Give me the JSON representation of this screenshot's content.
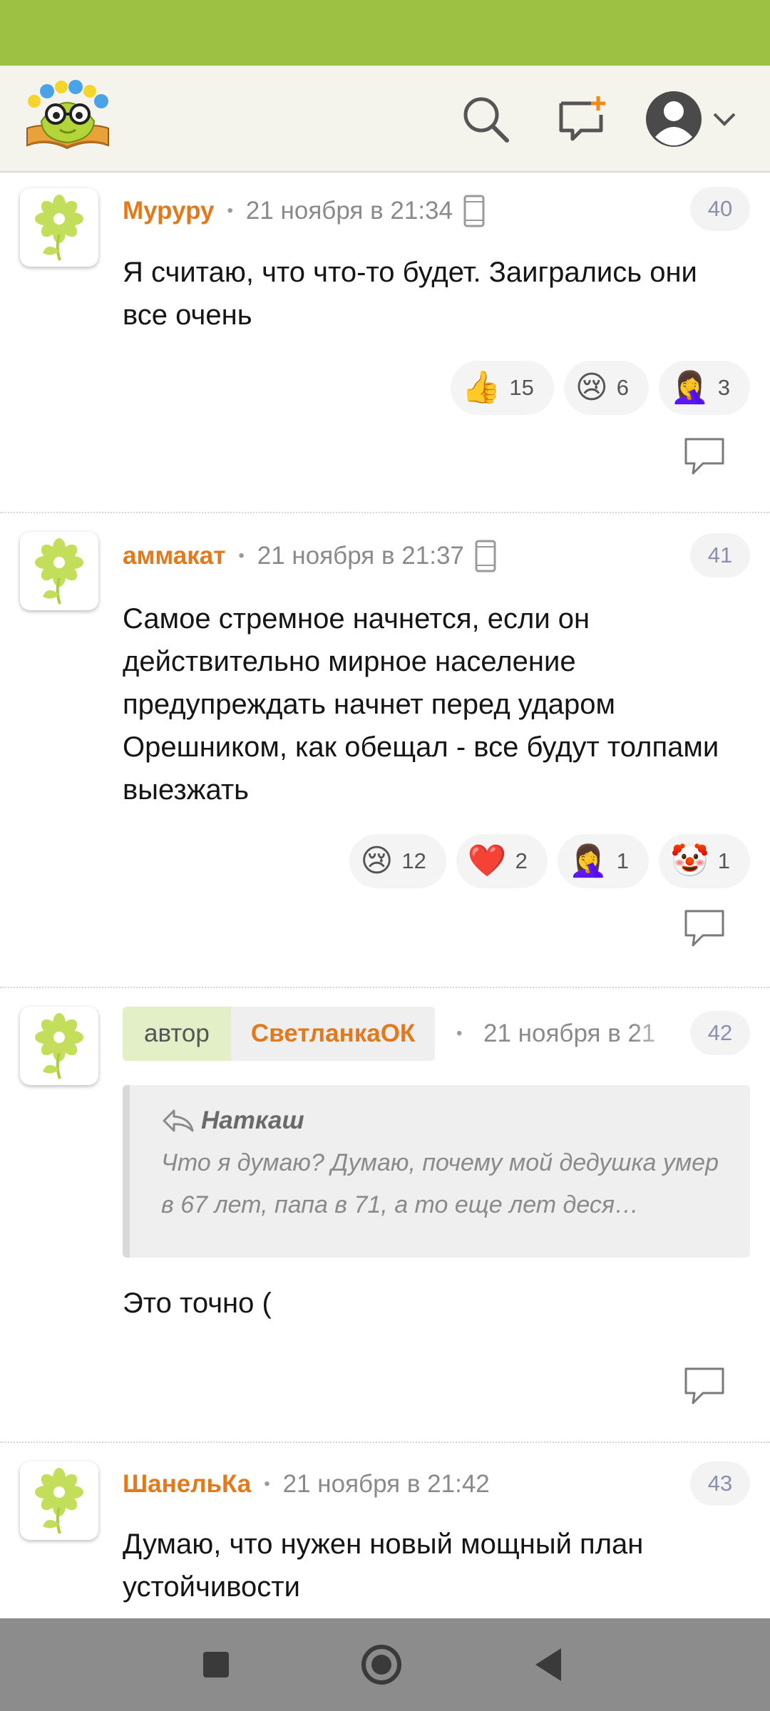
{
  "header": {
    "search_icon": "search-icon",
    "new_post_icon": "new-post-icon",
    "profile_icon": "profile-avatar-icon"
  },
  "colors": {
    "statusbar": "#9dc143",
    "author": "#e27a1d",
    "author_tag_bg": "#e3efc6"
  },
  "comments": [
    {
      "author": "Мururu",
      "author_display": "Муруру",
      "time": "21 ноября в 21:34",
      "number": "40",
      "device": "phone-icon",
      "text": "Я считаю, что что-то будет. Заигрались они все очень",
      "reactions": [
        {
          "emoji": "👍",
          "count": "15"
        },
        {
          "emoji": "😢",
          "count": "6"
        },
        {
          "emoji": "🤦‍♀️",
          "count": "3"
        }
      ]
    },
    {
      "author_display": "аммакат",
      "time": "21 ноября в 21:37",
      "number": "41",
      "device": "phone-icon",
      "text": "Самое стремное начнется, если он действительно мирное население предупреждать начнет перед ударом Орешником, как обещал - все будут толпами выезжать",
      "reactions": [
        {
          "emoji": "😢",
          "count": "12"
        },
        {
          "emoji": "❤️",
          "count": "2"
        },
        {
          "emoji": "🤦‍♀️",
          "count": "1"
        },
        {
          "emoji": "🤡",
          "count": "1"
        }
      ]
    },
    {
      "author_tag": "автор",
      "author_display": "СветланкаОК",
      "time": "21 ноября в 21",
      "number": "42",
      "quote": {
        "author": "Наткаш",
        "text": "Что я думаю? Думаю, почему мой дедушка умер в 67 лет, папа в 71, а то еще лет деся…"
      },
      "text": "Это точно ("
    },
    {
      "author_display": "ШанельКа",
      "time": "21 ноября в 21:42",
      "number": "43",
      "text": "Думаю, что нужен новый мощный план устойчивости"
    }
  ],
  "navbar": {
    "recents_icon": "recents-square-icon",
    "home_icon": "home-circle-icon",
    "back_icon": "back-triangle-icon"
  }
}
